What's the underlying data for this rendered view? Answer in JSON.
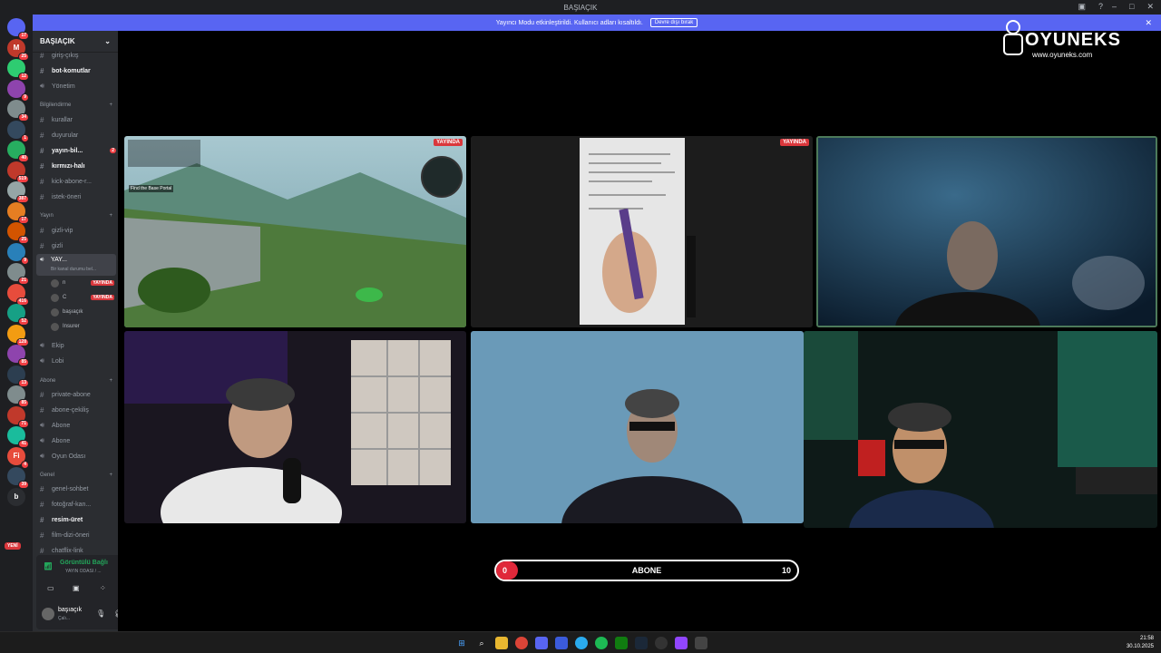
{
  "window": {
    "title": "BAŞIAÇIK"
  },
  "banner": {
    "text": "Yayıncı Modu etkinleştirildi. Kullanıcı adları kısaltıldı.",
    "button": "Devre dışı bırak"
  },
  "logo": {
    "brand": "OYUNEKS",
    "url": "www.oyuneks.com"
  },
  "guild": {
    "name": "BAŞIAÇIK"
  },
  "channels_top": [
    {
      "label": "giriş-çıkış",
      "type": "text",
      "bold": false
    },
    {
      "label": "bot-komutlar",
      "type": "text",
      "bold": true
    },
    {
      "label": "Yönetim",
      "type": "voice",
      "bold": false
    }
  ],
  "categories": {
    "bilgilendirme": "Bilgilendirme",
    "yayin": "Yayın",
    "abone": "Abone",
    "genel": "Genel"
  },
  "channels_bilgi": [
    {
      "label": "kurallar",
      "type": "text",
      "bold": false
    },
    {
      "label": "duyurular",
      "type": "text",
      "bold": false
    },
    {
      "label": "yayın-bil...",
      "type": "text",
      "bold": true,
      "badge": "2"
    },
    {
      "label": "kırmızı-halı",
      "type": "text",
      "bold": true
    },
    {
      "label": "kick-abone-r...",
      "type": "text",
      "bold": false
    },
    {
      "label": "istek-öneri",
      "type": "text",
      "bold": false
    }
  ],
  "channels_yayin": [
    {
      "label": "gizli-vip",
      "type": "text",
      "bold": false
    },
    {
      "label": "gizli",
      "type": "text",
      "bold": false
    }
  ],
  "active_voice": {
    "label": "YAY...",
    "topic": "Bir kanal durumu bel..."
  },
  "voice_users": [
    {
      "name": "n",
      "live": "YAYINDA"
    },
    {
      "name": "C",
      "live": "YAYINDA"
    },
    {
      "name": "başıaçık",
      "live": ""
    },
    {
      "name": "Insurer",
      "live": ""
    }
  ],
  "channels_yayin2": [
    {
      "label": "Ekip",
      "type": "voice"
    },
    {
      "label": "Lobi",
      "type": "voice"
    }
  ],
  "channels_abone": [
    {
      "label": "private-abone",
      "type": "text"
    },
    {
      "label": "abone-çekiliş",
      "type": "text"
    },
    {
      "label": "Abone",
      "type": "voice"
    },
    {
      "label": "Abone",
      "type": "voice"
    },
    {
      "label": "Oyun Odası",
      "type": "voice"
    }
  ],
  "channels_genel": [
    {
      "label": "genel-sohbet",
      "type": "text",
      "bold": false
    },
    {
      "label": "fotoğraf-kan...",
      "type": "text",
      "bold": false
    },
    {
      "label": "resim-üret",
      "type": "text",
      "bold": true
    },
    {
      "label": "film-dizi-öneri",
      "type": "text",
      "bold": false
    },
    {
      "label": "chatflix-link",
      "type": "text",
      "bold": false
    }
  ],
  "voice_panel": {
    "status": "Görüntülü Bağlı",
    "channel": "YAYIN ODASI / ..."
  },
  "user": {
    "name": "başıaçık",
    "status": "Çalı..."
  },
  "servers": [
    {
      "label": "",
      "color": "#5865f2",
      "badge": "17"
    },
    {
      "label": "M",
      "color": "#c0392b",
      "badge": "25"
    },
    {
      "label": "",
      "color": "#2ecc71",
      "badge": "12"
    },
    {
      "label": "",
      "color": "#8e44ad",
      "badge": "9"
    },
    {
      "label": "",
      "color": "#7f8c8d",
      "badge": "34"
    },
    {
      "label": "",
      "color": "#34495e",
      "badge": "1"
    },
    {
      "label": "",
      "color": "#27ae60",
      "badge": "40"
    },
    {
      "label": "",
      "color": "#c0392b",
      "badge": "519"
    },
    {
      "label": "",
      "color": "#95a5a6",
      "badge": "387"
    },
    {
      "label": "",
      "color": "#e67e22",
      "badge": "17"
    },
    {
      "label": "",
      "color": "#d35400",
      "badge": "25"
    },
    {
      "label": "",
      "color": "#2980b9",
      "badge": "9"
    },
    {
      "label": "",
      "color": "#7f8c8d",
      "badge": "21"
    },
    {
      "label": "",
      "color": "#e74c3c",
      "badge": "416"
    },
    {
      "label": "",
      "color": "#16a085",
      "badge": "52"
    },
    {
      "label": "",
      "color": "#f39c12",
      "badge": "128"
    },
    {
      "label": "",
      "color": "#8e44ad",
      "badge": "85"
    },
    {
      "label": "",
      "color": "#2c3e50",
      "badge": "13"
    },
    {
      "label": "",
      "color": "#7f8c8d",
      "badge": "85"
    },
    {
      "label": "",
      "color": "#c0392b",
      "badge": "71"
    },
    {
      "label": "",
      "color": "#1abc9c",
      "badge": "41"
    },
    {
      "label": "Fi",
      "color": "#e74c3c",
      "badge": "4"
    },
    {
      "label": "",
      "color": "#34495e",
      "badge": "39"
    },
    {
      "label": "b",
      "color": "#2b2d31",
      "badge": ""
    }
  ],
  "new_label": "YENİ",
  "tiles": {
    "live": "YAYINDA",
    "game_hint": "Find the Base Portal"
  },
  "progress": {
    "current": "0",
    "label": "ABONE",
    "max": "10",
    "fraction": 0
  },
  "clock": {
    "time": "21:58",
    "date": "30.10.2025"
  }
}
